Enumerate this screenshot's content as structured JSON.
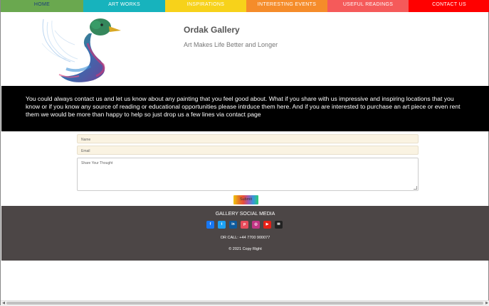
{
  "nav": {
    "items": [
      {
        "label": "HOME",
        "bg": "#6aa84f",
        "color": "#1a3d7a",
        "width": 116
      },
      {
        "label": "ART WORKS",
        "bg": "#17b3bd",
        "color": "#ffffff",
        "width": 115
      },
      {
        "label": "INSPIRATIONS",
        "bg": "#f7d21a",
        "color": "#ffffff",
        "width": 114
      },
      {
        "label": "INTERESTING EVENTS",
        "bg": "#f58c2a",
        "color": "#ffffff",
        "width": 114
      },
      {
        "label": "USEFUL READINGS",
        "bg": "#f55a5a",
        "color": "#ffffff",
        "width": 114
      },
      {
        "label": "CONTACT US",
        "bg": "#ff0000",
        "color": "#ffffff",
        "width": 114
      }
    ]
  },
  "header": {
    "title": "Ordak Gallery",
    "subtitle": "Art Makes Life Better and Longer"
  },
  "band": {
    "text": "You could always contact us and let us know about any painting that you feel good about. What if you share with us impressive and inspiring locations that you know or if you know any source of reading or educational opportunities please intrduce them here. And if you are interested to purchase an art piece or even rent them we would be more than happy to help so just drop us a few lines via  contact page"
  },
  "form": {
    "name_placeholder": "Name",
    "email_placeholder": "Email",
    "message_placeholder": "Share Your Thought",
    "submit_label": "Submit"
  },
  "footer": {
    "social_title": "GALLERY SOCIAL MEDIA",
    "social": [
      {
        "icon": "facebook-icon",
        "glyph": "f",
        "color": "#1877f2"
      },
      {
        "icon": "twitter-icon",
        "glyph": "t",
        "color": "#1da1f2"
      },
      {
        "icon": "linkedin-icon",
        "glyph": "in",
        "color": "#0e5a9c"
      },
      {
        "icon": "pinterest-icon",
        "glyph": "p",
        "color": "#e74c5b"
      },
      {
        "icon": "instagram-icon",
        "glyph": "◎",
        "color": "#c13584"
      },
      {
        "icon": "youtube-icon",
        "glyph": "▶",
        "color": "#e62117"
      },
      {
        "icon": "email-icon",
        "glyph": "✉",
        "color": "#222222"
      }
    ],
    "call": "OR CALL: +44 7700 900077",
    "copyright": "© 2021 Copy Right"
  }
}
